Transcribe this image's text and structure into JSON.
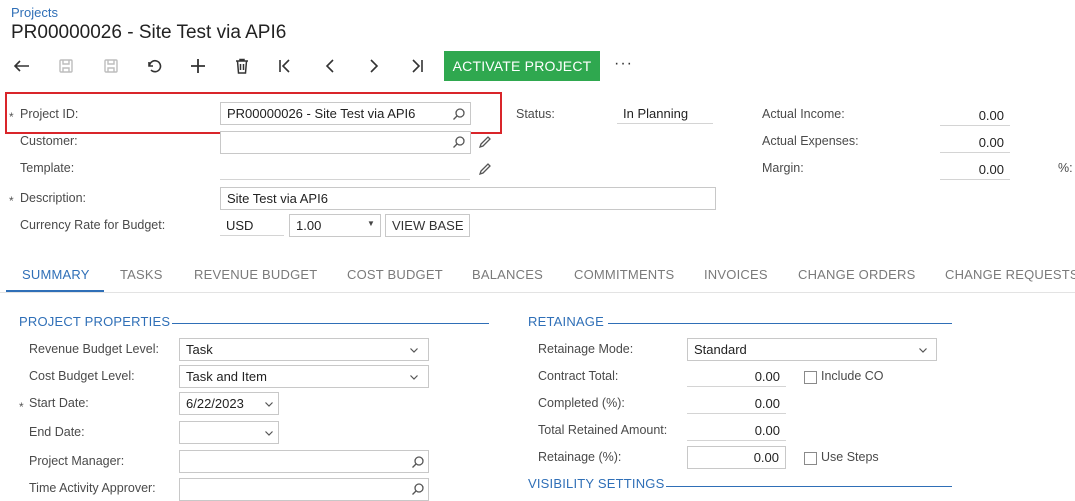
{
  "breadcrumb": "Projects",
  "page_title": "PR00000026 - Site Test via API6",
  "toolbar": {
    "activate_label": "ACTIVATE PROJECT",
    "more_label": "···"
  },
  "summary": {
    "project_id_label": "Project ID:",
    "project_id_value": "PR00000026 - Site Test via API6",
    "customer_label": "Customer:",
    "customer_value": "",
    "template_label": "Template:",
    "template_value": "",
    "description_label": "Description:",
    "description_value": "Site Test via API6",
    "currency_label": "Currency Rate for Budget:",
    "currency_value": "USD",
    "rate_value": "1.00",
    "view_base_label": "VIEW BASE",
    "status_label": "Status:",
    "status_value": "In Planning",
    "actual_income_label": "Actual Income:",
    "actual_income_value": "0.00",
    "actual_expenses_label": "Actual Expenses:",
    "actual_expenses_value": "0.00",
    "margin_label": "Margin:",
    "margin_value": "0.00",
    "margin_pct_label": "%:",
    "required_mark": "*"
  },
  "tabs": [
    {
      "label": "SUMMARY",
      "active": true
    },
    {
      "label": "TASKS"
    },
    {
      "label": "REVENUE BUDGET"
    },
    {
      "label": "COST BUDGET"
    },
    {
      "label": "BALANCES"
    },
    {
      "label": "COMMITMENTS"
    },
    {
      "label": "INVOICES"
    },
    {
      "label": "CHANGE ORDERS"
    },
    {
      "label": "CHANGE REQUESTS"
    }
  ],
  "project_properties": {
    "section_title": "PROJECT PROPERTIES",
    "revenue_budget_level_label": "Revenue Budget Level:",
    "revenue_budget_level_value": "Task",
    "cost_budget_level_label": "Cost Budget Level:",
    "cost_budget_level_value": "Task and Item",
    "start_date_label": "Start Date:",
    "start_date_value": "6/22/2023",
    "end_date_label": "End Date:",
    "end_date_value": "",
    "project_manager_label": "Project Manager:",
    "project_manager_value": "",
    "time_activity_approver_label": "Time Activity Approver:",
    "time_activity_approver_value": ""
  },
  "retainage": {
    "section_title": "RETAINAGE",
    "mode_label": "Retainage Mode:",
    "mode_value": "Standard",
    "contract_total_label": "Contract Total:",
    "contract_total_value": "0.00",
    "include_co_label": "Include CO",
    "completed_label": "Completed (%):",
    "completed_value": "0.00",
    "total_retained_label": "Total Retained Amount:",
    "total_retained_value": "0.00",
    "retainage_pct_label": "Retainage (%):",
    "retainage_pct_value": "0.00",
    "use_steps_label": "Use Steps"
  },
  "visibility": {
    "section_title": "VISIBILITY SETTINGS"
  },
  "colors": {
    "accent": "#2f6fb7",
    "primary_button": "#2fa84f",
    "highlight": "#d9252a"
  }
}
